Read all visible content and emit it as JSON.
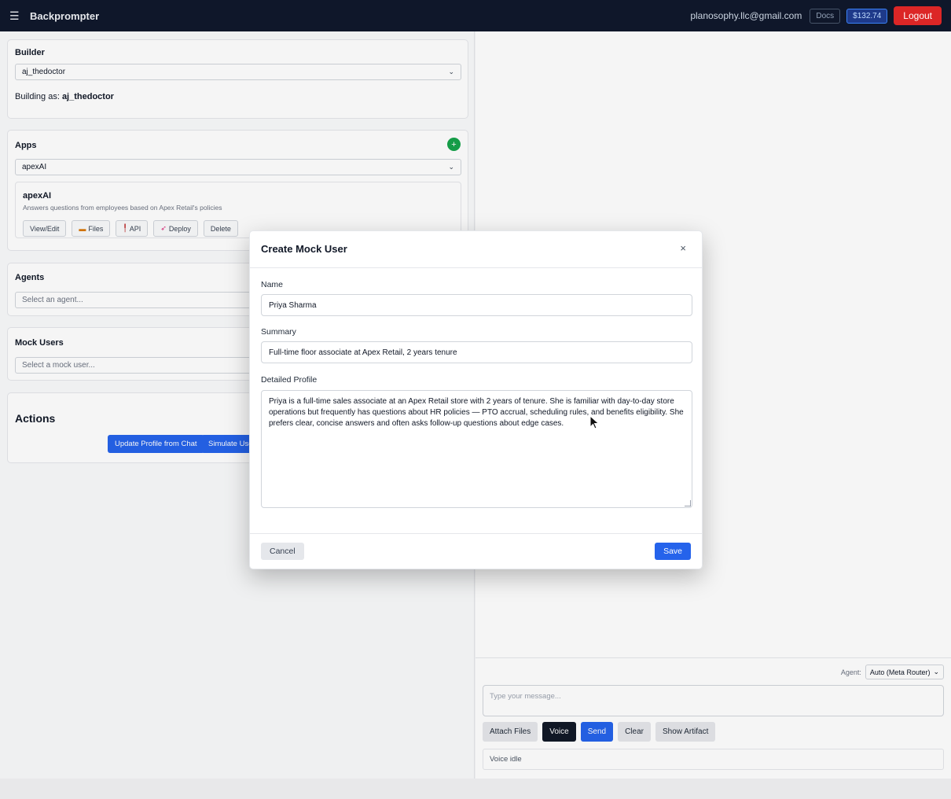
{
  "header": {
    "menu_icon": "hamburger-icon",
    "brand": "Backprompter",
    "email": "planosophy.llc@gmail.com",
    "docs_label": "Docs",
    "balance": "$132.74",
    "logout_label": "Logout"
  },
  "builder": {
    "title": "Builder",
    "selected": "aj_thedoctor",
    "building_as_prefix": "Building as: ",
    "building_as_name": "aj_thedoctor"
  },
  "apps": {
    "title": "Apps",
    "add_label": "+",
    "selected": "apexAI",
    "app_name": "apexAI",
    "app_description": "Answers questions from employees based on Apex Retail's policies",
    "actions": [
      {
        "label": "View/Edit",
        "icon": ""
      },
      {
        "label": "Files",
        "icon": "folder-icon"
      },
      {
        "label": "API",
        "icon": "pin-icon"
      },
      {
        "label": "Deploy",
        "icon": "rocket-icon"
      },
      {
        "label": "Delete",
        "icon": ""
      }
    ]
  },
  "agents": {
    "title": "Agents",
    "placeholder": "Select an agent..."
  },
  "mock_users": {
    "title": "Mock Users",
    "placeholder": "Select a mock user..."
  },
  "actions_section": {
    "title": "Actions",
    "update_profile_label": "Update Profile from Chat",
    "simulate_label": "Simulate User"
  },
  "chat": {
    "agent_label": "Agent:",
    "agent_selected": "Auto (Meta Router)",
    "message_placeholder": "Type your message...",
    "buttons": {
      "attach": "Attach Files",
      "voice": "Voice",
      "send": "Send",
      "clear": "Clear",
      "artifact": "Show Artifact"
    },
    "voice_status": "Voice idle"
  },
  "modal": {
    "title": "Create Mock User",
    "close": "×",
    "name_label": "Name",
    "name_value": "Priya Sharma",
    "summary_label": "Summary",
    "summary_value": "Full-time floor associate at Apex Retail, 2 years tenure",
    "profile_label": "Detailed Profile",
    "profile_value": "Priya is a full-time sales associate at an Apex Retail store with 2 years of tenure. She is familiar with day-to-day store operations but frequently has questions about HR policies — PTO accrual, scheduling rules, and benefits eligibility. She prefers clear, concise answers and often asks follow-up questions about edge cases.",
    "cancel_label": "Cancel",
    "save_label": "Save"
  }
}
